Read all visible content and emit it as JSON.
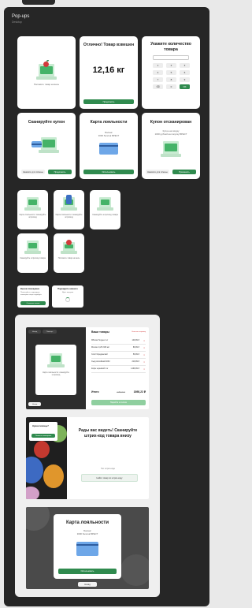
{
  "page": {
    "title": "Pop-ups",
    "subtitle": "Desktop"
  },
  "cards_row1": {
    "place_item": {
      "text": "Положите товар на весы"
    },
    "weighed": {
      "title": "Отлично! Товар взвешен",
      "weight": "12,16 кг",
      "button": "Продолжить"
    },
    "quantity": {
      "title": "Укажите количество товара",
      "keys": [
        "1",
        "2",
        "3",
        "4",
        "5",
        "6",
        "7",
        "8",
        "9",
        "⌫",
        "0",
        "OK"
      ]
    }
  },
  "cards_row2": {
    "scan_coupon": {
      "title": "Сканируйте купон",
      "cancel": "Нажмите для отмены",
      "continue": "Продолжить"
    },
    "loyalty": {
      "title": "Карта лояльности",
      "label": "Баланс",
      "points": "3000 баллов ВРЕСТ",
      "button": "Использовать"
    },
    "coupon_scanned": {
      "title": "Купон отсканирован",
      "label": "Купон на скидку",
      "discount": "1000 рублей на покупку ВРЕСТ",
      "cancel": "Нажмите для отмены",
      "apply": "Применить"
    }
  },
  "small_cards": [
    {
      "text": "Карта лояльности: сканируйте штрихкод"
    },
    {
      "text": "Карта лояльности: сканируйте штрихкод"
    },
    {
      "text": "Сканируйте штрихкод товара"
    },
    {
      "text": "Сканируйте штрихкод товара"
    },
    {
      "text": "Положите товар на весы"
    }
  ],
  "mini_popups": [
    {
      "title": "Вызов помощника",
      "text": "Пожалуйста, подождите, помощник скоро подойдёт",
      "button": "Отменить вызов"
    },
    {
      "title": "Подождите немного",
      "text": "Идёт загрузка"
    }
  ],
  "cart_screen": {
    "top_left": "Назад",
    "top_right": "Помощь",
    "popup_text": "Карта лояльности: сканируйте штрихкод",
    "bottom_button": "Назад",
    "heading": "Ваши товары",
    "clear": "Очистить корзину",
    "items": [
      {
        "name": "Яблоки Голден 1 кг",
        "price": "149,99 ₽"
      },
      {
        "name": "Молоко 3,2% 930 мл",
        "price": "89,99 ₽"
      },
      {
        "name": "Хлеб бородинский",
        "price": "59,99 ₽"
      },
      {
        "name": "Сыр российский 200 г",
        "price": "219,99 ₽"
      },
      {
        "name": "Кофе зерновой 1 кг",
        "price": "1499,99 ₽"
      }
    ],
    "total_label": "Итого",
    "old_total": "2158,70 ₽",
    "total": "1898,22 ₽",
    "pay_button": "Перейти к оплате"
  },
  "welcome_screen": {
    "help_title": "Нужна помощь?",
    "help_button": "Позвать помощника",
    "title": "Рады вас видеть! Сканируйте штрих-код товара внизу",
    "no_barcode": "Нет штрих-кода",
    "search_button": "Найти товар по штрих-коду"
  },
  "loyalty_screen": {
    "title": "Карта лояльности",
    "label": "Баланс",
    "points": "3000 баллов ВРЕСТ",
    "button": "Использовать",
    "back": "Назад"
  }
}
